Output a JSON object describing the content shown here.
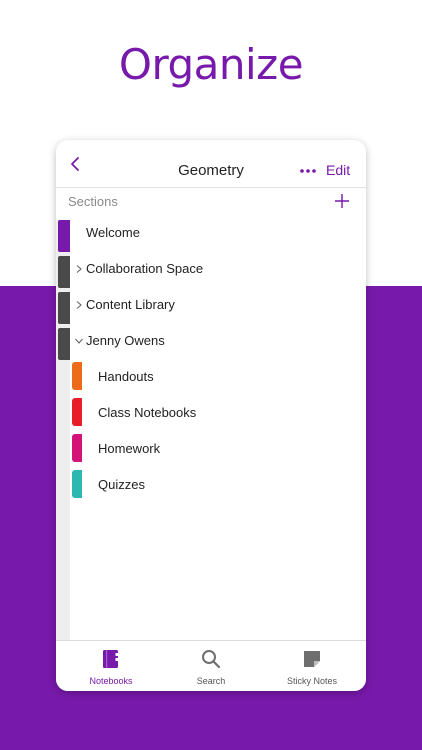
{
  "headline": "Organize",
  "colors": {
    "accent": "#7719aa",
    "notebook_tab_1": "#7719aa",
    "notebook_tab_other": "#4a4a4a",
    "section_handouts": "#ec6c1a",
    "section_class_notebooks": "#e81f2a",
    "section_homework": "#d41379",
    "section_quizzes": "#2cb7b1"
  },
  "navbar": {
    "back_icon": "chevron-left-icon",
    "title": "Geometry",
    "more_icon": "ellipsis-icon",
    "edit_label": "Edit"
  },
  "sections": {
    "header": "Sections",
    "add_icon": "plus-icon",
    "items": [
      {
        "label": "Welcome"
      },
      {
        "label": "Collaboration Space",
        "expanded": false
      },
      {
        "label": "Content Library",
        "expanded": false
      },
      {
        "label": "Jenny Owens",
        "expanded": true
      },
      {
        "label": "Handouts"
      },
      {
        "label": "Class Notebooks"
      },
      {
        "label": "Homework"
      },
      {
        "label": "Quizzes"
      }
    ]
  },
  "tabbar": {
    "tabs": [
      {
        "label": "Notebooks",
        "icon": "notebook-icon",
        "active": true
      },
      {
        "label": "Search",
        "icon": "search-icon",
        "active": false
      },
      {
        "label": "Sticky Notes",
        "icon": "sticky-note-icon",
        "active": false
      }
    ]
  }
}
